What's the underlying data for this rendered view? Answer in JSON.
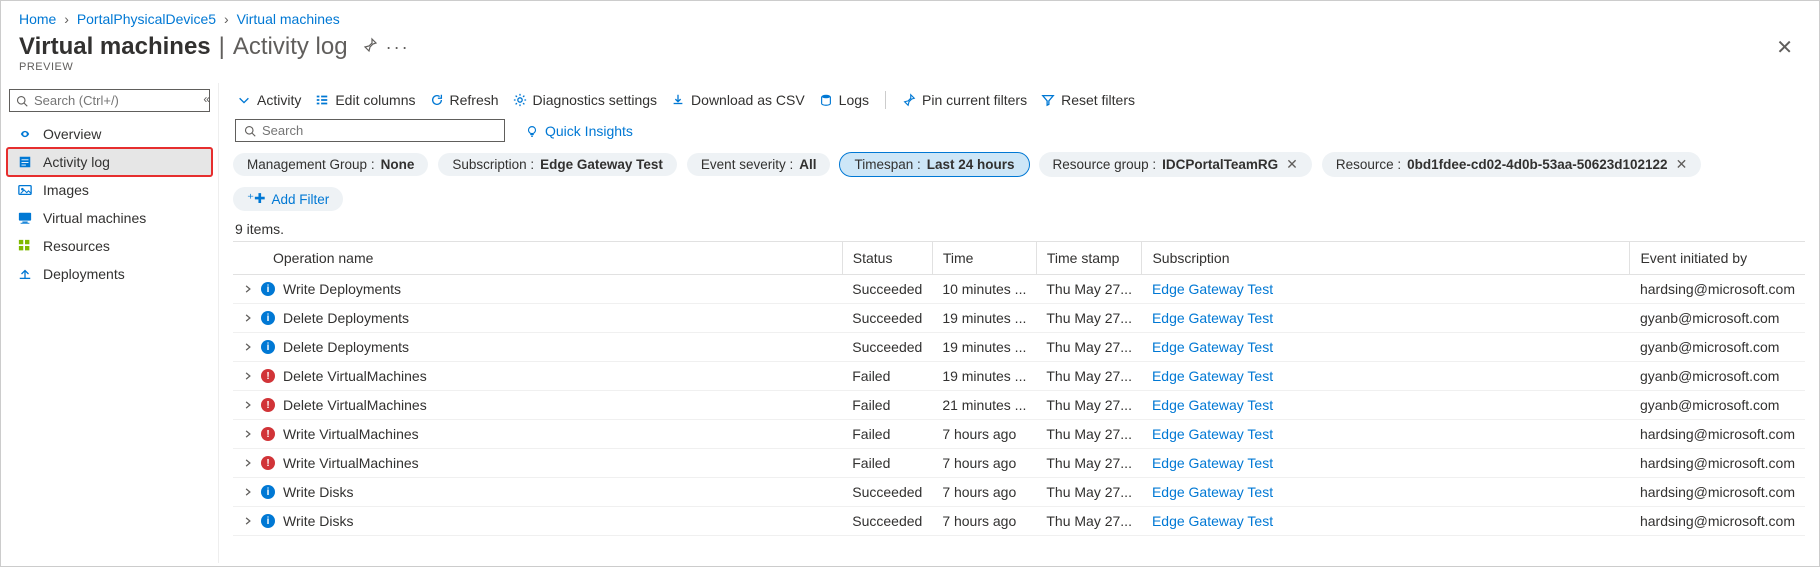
{
  "breadcrumb": {
    "home": "Home",
    "p1": "PortalPhysicalDevice5",
    "p2": "Virtual machines"
  },
  "header": {
    "title": "Virtual machines",
    "subtitle": "Activity log",
    "preview": "PREVIEW"
  },
  "sidebar": {
    "search_placeholder": "Search (Ctrl+/)",
    "items": [
      {
        "label": "Overview"
      },
      {
        "label": "Activity log"
      },
      {
        "label": "Images"
      },
      {
        "label": "Virtual machines"
      },
      {
        "label": "Resources"
      },
      {
        "label": "Deployments"
      }
    ]
  },
  "toolbar": {
    "activity": "Activity",
    "edit_columns": "Edit columns",
    "refresh": "Refresh",
    "diagnostics": "Diagnostics settings",
    "csv": "Download as CSV",
    "logs": "Logs",
    "pin": "Pin current filters",
    "reset": "Reset filters"
  },
  "main": {
    "search_placeholder": "Search",
    "quick_insights": "Quick Insights",
    "pills": {
      "mg_label": "Management Group :",
      "mg_value": "None",
      "sub_label": "Subscription :",
      "sub_value": "Edge Gateway Test",
      "sev_label": "Event severity :",
      "sev_value": "All",
      "ts_label": "Timespan :",
      "ts_value": "Last 24 hours",
      "rg_label": "Resource group :",
      "rg_value": "IDCPortalTeamRG",
      "res_label": "Resource :",
      "res_value": "0bd1fdee-cd02-4d0b-53aa-50623d102122",
      "add": "Add Filter"
    },
    "count": "9 items.",
    "columns": {
      "op": "Operation name",
      "status": "Status",
      "time": "Time",
      "ts": "Time stamp",
      "sub": "Subscription",
      "init": "Event initiated by"
    },
    "rows": [
      {
        "op": "Write Deployments",
        "status": "Succeeded",
        "ok": true,
        "time": "10 minutes ...",
        "ts": "Thu May 27...",
        "sub": "Edge Gateway Test",
        "init": "hardsing@microsoft.com"
      },
      {
        "op": "Delete Deployments",
        "status": "Succeeded",
        "ok": true,
        "time": "19 minutes ...",
        "ts": "Thu May 27...",
        "sub": "Edge Gateway Test",
        "init": "gyanb@microsoft.com"
      },
      {
        "op": "Delete Deployments",
        "status": "Succeeded",
        "ok": true,
        "time": "19 minutes ...",
        "ts": "Thu May 27...",
        "sub": "Edge Gateway Test",
        "init": "gyanb@microsoft.com"
      },
      {
        "op": "Delete VirtualMachines",
        "status": "Failed",
        "ok": false,
        "time": "19 minutes ...",
        "ts": "Thu May 27...",
        "sub": "Edge Gateway Test",
        "init": "gyanb@microsoft.com"
      },
      {
        "op": "Delete VirtualMachines",
        "status": "Failed",
        "ok": false,
        "time": "21 minutes ...",
        "ts": "Thu May 27...",
        "sub": "Edge Gateway Test",
        "init": "gyanb@microsoft.com"
      },
      {
        "op": "Write VirtualMachines",
        "status": "Failed",
        "ok": false,
        "time": "7 hours ago",
        "ts": "Thu May 27...",
        "sub": "Edge Gateway Test",
        "init": "hardsing@microsoft.com"
      },
      {
        "op": "Write VirtualMachines",
        "status": "Failed",
        "ok": false,
        "time": "7 hours ago",
        "ts": "Thu May 27...",
        "sub": "Edge Gateway Test",
        "init": "hardsing@microsoft.com"
      },
      {
        "op": "Write Disks",
        "status": "Succeeded",
        "ok": true,
        "time": "7 hours ago",
        "ts": "Thu May 27...",
        "sub": "Edge Gateway Test",
        "init": "hardsing@microsoft.com"
      },
      {
        "op": "Write Disks",
        "status": "Succeeded",
        "ok": true,
        "time": "7 hours ago",
        "ts": "Thu May 27...",
        "sub": "Edge Gateway Test",
        "init": "hardsing@microsoft.com"
      }
    ]
  }
}
